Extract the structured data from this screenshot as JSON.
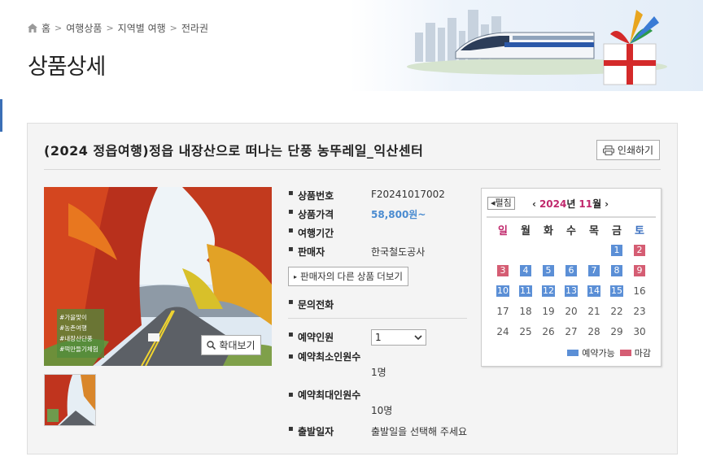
{
  "breadcrumb": {
    "home": "홈",
    "items": [
      "여행상품",
      "지역별 여행",
      "전라권"
    ]
  },
  "page_title": "상품상세",
  "product": {
    "title": "(2024 정읍여행)정읍 내장산으로 떠나는 단풍 농뚜레일_익산센터",
    "print_label": "인쇄하기",
    "zoom_label": "확대보기",
    "tags": [
      "#가을맞이",
      "#농촌여행",
      "#내장산단풍",
      "#떡만들기체험"
    ]
  },
  "info": {
    "code_label": "상품번호",
    "code_value": "F20241017002",
    "price_label": "상품가격",
    "price_value": "58,800원~",
    "period_label": "여행기간",
    "seller_label": "판매자",
    "seller_value": "한국철도공사",
    "seller_more_label": "판매자의 다른 상품 더보기",
    "phone_label": "문의전화",
    "people_label": "예약인원",
    "people_value": "1",
    "min_label": "예약최소인원수",
    "min_value": "1명",
    "max_label": "예약최대인원수",
    "max_value": "10명",
    "depart_label": "출발일자",
    "depart_value": "출발일을 선택해 주세요"
  },
  "calendar": {
    "fold_label": "◂펼침",
    "prev": "‹",
    "next": "›",
    "year": "2024",
    "year_suffix": "년",
    "month": "11",
    "month_suffix": "월",
    "weekdays": [
      "일",
      "월",
      "화",
      "수",
      "목",
      "금",
      "토"
    ],
    "weeks": [
      [
        null,
        null,
        null,
        null,
        null,
        {
          "d": "1",
          "s": "avail"
        },
        {
          "d": "2",
          "s": "closed"
        }
      ],
      [
        {
          "d": "3",
          "s": "closed"
        },
        {
          "d": "4",
          "s": "avail"
        },
        {
          "d": "5",
          "s": "avail"
        },
        {
          "d": "6",
          "s": "avail"
        },
        {
          "d": "7",
          "s": "avail"
        },
        {
          "d": "8",
          "s": "avail"
        },
        {
          "d": "9",
          "s": "closed"
        }
      ],
      [
        {
          "d": "10",
          "s": "avail"
        },
        {
          "d": "11",
          "s": "avail"
        },
        {
          "d": "12",
          "s": "avail"
        },
        {
          "d": "13",
          "s": "avail"
        },
        {
          "d": "14",
          "s": "avail"
        },
        {
          "d": "15",
          "s": "avail"
        },
        {
          "d": "16",
          "s": ""
        }
      ],
      [
        {
          "d": "17",
          "s": ""
        },
        {
          "d": "18",
          "s": ""
        },
        {
          "d": "19",
          "s": ""
        },
        {
          "d": "20",
          "s": ""
        },
        {
          "d": "21",
          "s": ""
        },
        {
          "d": "22",
          "s": ""
        },
        {
          "d": "23",
          "s": ""
        }
      ],
      [
        {
          "d": "24",
          "s": ""
        },
        {
          "d": "25",
          "s": ""
        },
        {
          "d": "26",
          "s": ""
        },
        {
          "d": "27",
          "s": ""
        },
        {
          "d": "28",
          "s": ""
        },
        {
          "d": "29",
          "s": ""
        },
        {
          "d": "30",
          "s": ""
        }
      ]
    ],
    "legend_available": "예약가능",
    "legend_closed": "마감",
    "color_available": "#5b8fd6",
    "color_closed": "#d55d73"
  }
}
